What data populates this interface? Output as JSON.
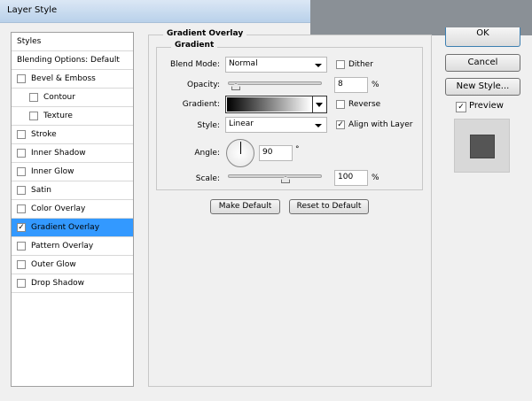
{
  "window": {
    "title": "Layer Style"
  },
  "sidebar": {
    "items": [
      {
        "label": "Styles",
        "checkbox": false
      },
      {
        "label": "Blending Options: Default",
        "checkbox": false
      },
      {
        "label": "Bevel & Emboss",
        "checkbox": true,
        "checked": false
      },
      {
        "label": "Contour",
        "checkbox": true,
        "checked": false,
        "indent": true
      },
      {
        "label": "Texture",
        "checkbox": true,
        "checked": false,
        "indent": true
      },
      {
        "label": "Stroke",
        "checkbox": true,
        "checked": false
      },
      {
        "label": "Inner Shadow",
        "checkbox": true,
        "checked": false
      },
      {
        "label": "Inner Glow",
        "checkbox": true,
        "checked": false
      },
      {
        "label": "Satin",
        "checkbox": true,
        "checked": false
      },
      {
        "label": "Color Overlay",
        "checkbox": true,
        "checked": false
      },
      {
        "label": "Gradient Overlay",
        "checkbox": true,
        "checked": true,
        "selected": true
      },
      {
        "label": "Pattern Overlay",
        "checkbox": true,
        "checked": false
      },
      {
        "label": "Outer Glow",
        "checkbox": true,
        "checked": false
      },
      {
        "label": "Drop Shadow",
        "checkbox": true,
        "checked": false
      }
    ]
  },
  "main": {
    "section_title": "Gradient Overlay",
    "group_title": "Gradient",
    "blend_mode": {
      "label": "Blend Mode:",
      "value": "Normal"
    },
    "dither": {
      "label": "Dither",
      "checked": false
    },
    "opacity": {
      "label": "Opacity:",
      "value": "8",
      "unit": "%",
      "slider_percent": 8
    },
    "gradient": {
      "label": "Gradient:"
    },
    "reverse": {
      "label": "Reverse",
      "checked": false
    },
    "style": {
      "label": "Style:",
      "value": "Linear"
    },
    "align": {
      "label": "Align with Layer",
      "checked": true
    },
    "angle": {
      "label": "Angle:",
      "value": "90",
      "unit": "°"
    },
    "scale": {
      "label": "Scale:",
      "value": "100",
      "unit": "%",
      "slider_percent": 60
    },
    "make_default": "Make Default",
    "reset_default": "Reset to Default"
  },
  "buttons": {
    "ok": "OK",
    "cancel": "Cancel",
    "new_style": "New Style...",
    "preview": "Preview",
    "preview_checked": true
  },
  "colors": {
    "selection": "#3399ff",
    "preview_swatch": "#555555"
  }
}
